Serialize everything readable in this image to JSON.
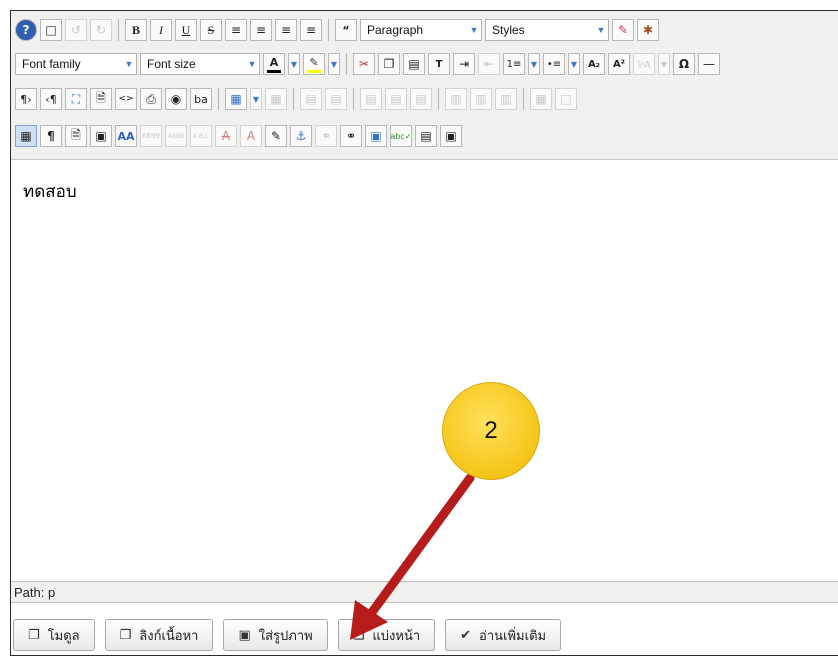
{
  "toolbar": {
    "row1": {
      "format_select": "Paragraph",
      "styles_select": "Styles"
    },
    "row2": {
      "font_family": "Font family",
      "font_size": "Font size"
    }
  },
  "editor": {
    "content": "ทดสอบ"
  },
  "status": {
    "path": "Path: p"
  },
  "actions": {
    "module": "โมดูล",
    "content_link": "ลิงก์เนื้อหา",
    "insert_image": "ใส่รูปภาพ",
    "page_break": "แบ่งหน้า",
    "read_more": "อ่านเพิ่มเติม"
  },
  "callout": {
    "number": "2",
    "color": "#f5c518",
    "arrow_color": "#b71c1c"
  }
}
